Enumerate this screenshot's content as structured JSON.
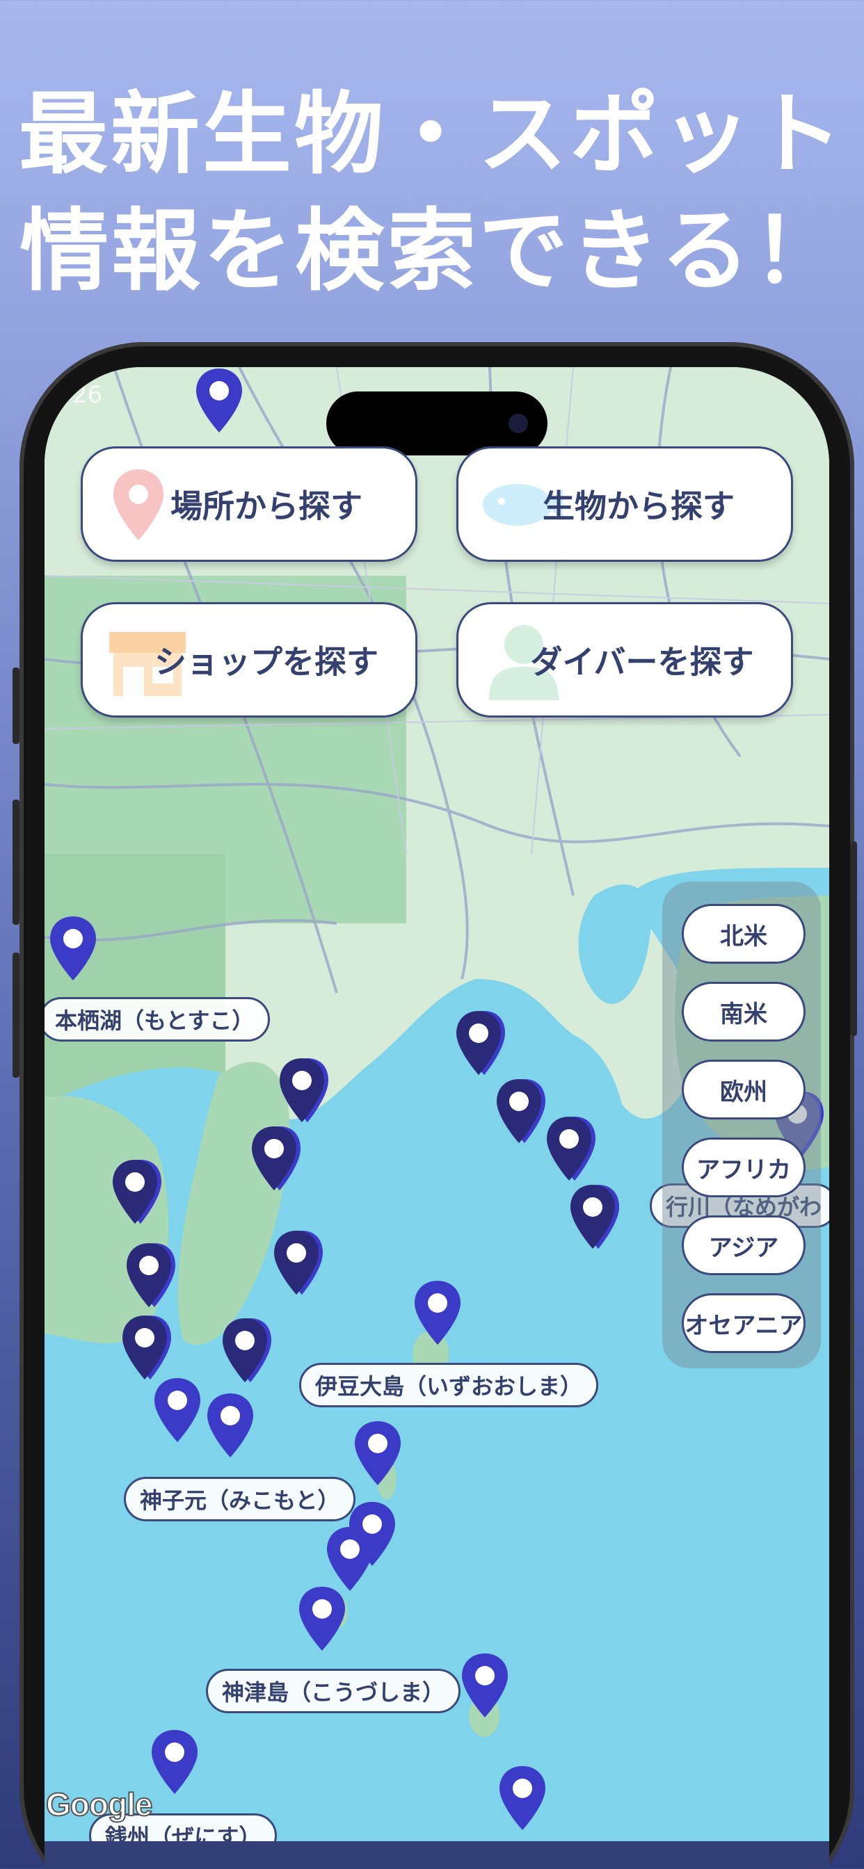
{
  "headline": {
    "line1": "最新生物・スポット",
    "line2": "情報を検索できる！"
  },
  "status_bar": {
    "time": "26"
  },
  "categories": [
    {
      "label": "場所から探す",
      "icon": "location-pin-icon"
    },
    {
      "label": "生物から探す",
      "icon": "fish-icon"
    },
    {
      "label": "ショップを探す",
      "icon": "shop-icon"
    },
    {
      "label": "ダイバーを探す",
      "icon": "person-icon"
    }
  ],
  "regions": [
    "北米",
    "南米",
    "欧州",
    "アフリカ",
    "アジア",
    "オセアニア"
  ],
  "places": [
    "本栖湖（もとすこ）",
    "行川（なめがわ",
    "伊豆大島（いずおおしま）",
    "神子元（みこもと）",
    "神津島（こうづしま）",
    "銭州（ぜにす）"
  ],
  "map": {
    "attribution": "Google"
  },
  "colors": {
    "accent": "#3a4a7e",
    "pin_dark": "#2a2a78",
    "pin_light": "#3b3bc8",
    "sea": "#7fd3ea",
    "land": "#a9dcb8"
  }
}
